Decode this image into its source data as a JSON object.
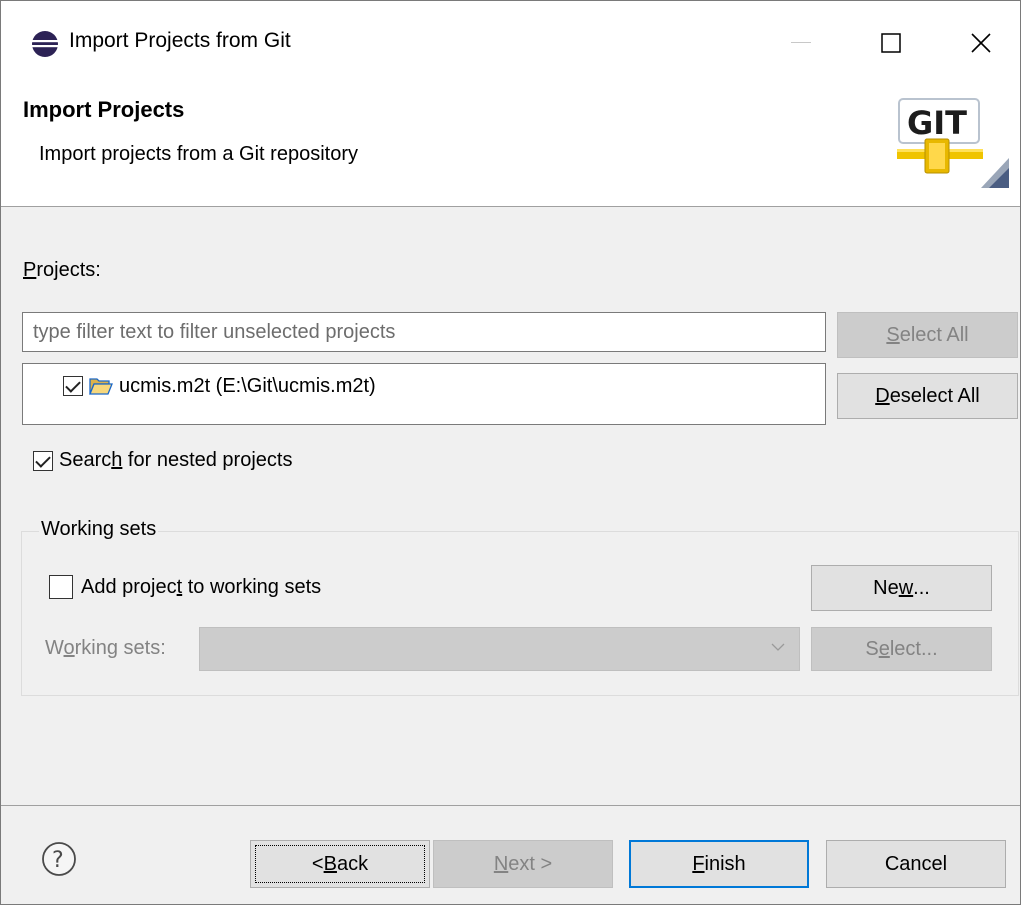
{
  "window": {
    "title": "Import Projects from Git",
    "accent_color": "#0078d7"
  },
  "banner": {
    "title": "Import Projects",
    "subtitle": "Import projects from a Git repository",
    "logo_text": "GIT"
  },
  "projects": {
    "label_prefix": "",
    "label_accel": "P",
    "label_rest": "rojects:",
    "filter_placeholder": "type filter text to filter unselected projects",
    "items": [
      {
        "label": "ucmis.m2t (E:\\Git\\ucmis.m2t)",
        "checked": true
      }
    ],
    "select_all_accel": "S",
    "select_all_rest": "elect All",
    "deselect_all_accel": "D",
    "deselect_all_rest": "eselect All"
  },
  "nested": {
    "label_prefix": "Searc",
    "label_accel": "h",
    "label_rest": " for nested projects",
    "checked": true
  },
  "working_sets": {
    "group_label": "Working sets",
    "add_prefix": "Add projec",
    "add_accel": "t",
    "add_rest": " to working sets",
    "add_checked": false,
    "new_prefix": "Ne",
    "new_accel": "w",
    "new_rest": "...",
    "ws_label_prefix": "W",
    "ws_label_accel": "o",
    "ws_label_rest": "rking sets:",
    "ws_value": "",
    "select_prefix": "S",
    "select_accel": "e",
    "select_rest": "lect..."
  },
  "footer": {
    "back_prefix": "< ",
    "back_accel": "B",
    "back_rest": "ack",
    "next_accel": "N",
    "next_rest": "ext >",
    "finish_accel": "F",
    "finish_rest": "inish",
    "cancel_label": "Cancel"
  }
}
